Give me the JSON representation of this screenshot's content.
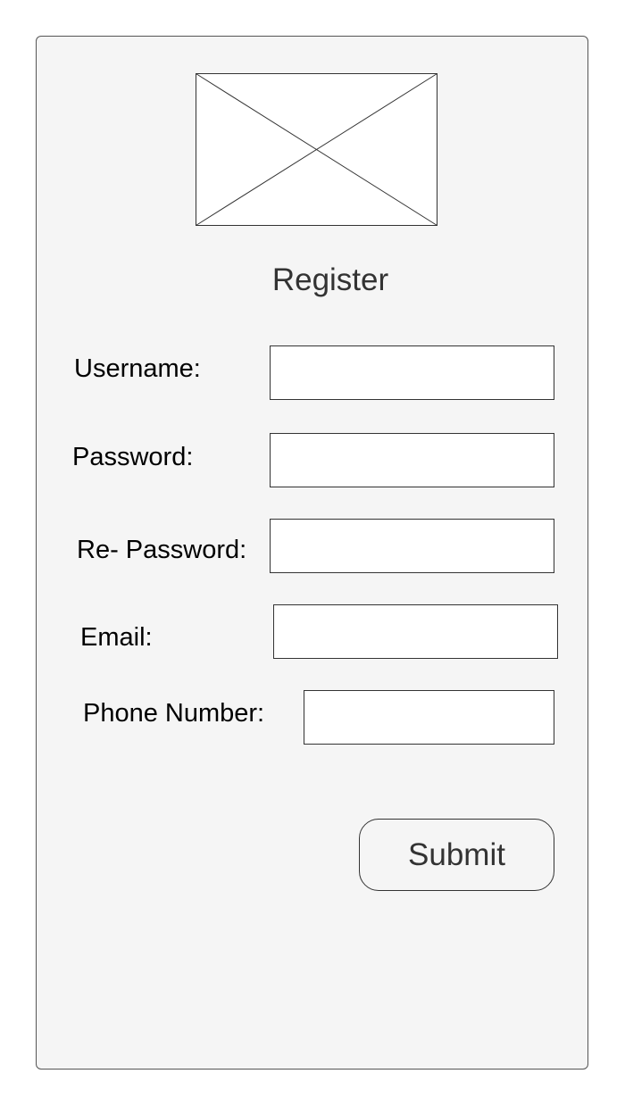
{
  "form": {
    "title": "Register",
    "logo": {
      "icon": "image-placeholder-icon"
    },
    "fields": {
      "username": {
        "label": "Username:",
        "value": "",
        "placeholder": ""
      },
      "password": {
        "label": "Password:",
        "value": "",
        "placeholder": ""
      },
      "re_password": {
        "label": "Re- Password:",
        "value": "",
        "placeholder": ""
      },
      "email": {
        "label": "Email:",
        "value": "",
        "placeholder": ""
      },
      "phone_number": {
        "label": "Phone Number:",
        "value": "",
        "placeholder": ""
      }
    },
    "submit_label": "Submit"
  },
  "colors": {
    "panel_background": "#f5f5f5",
    "field_background": "#ffffff",
    "border": "#333333",
    "title_text": "#333333"
  }
}
